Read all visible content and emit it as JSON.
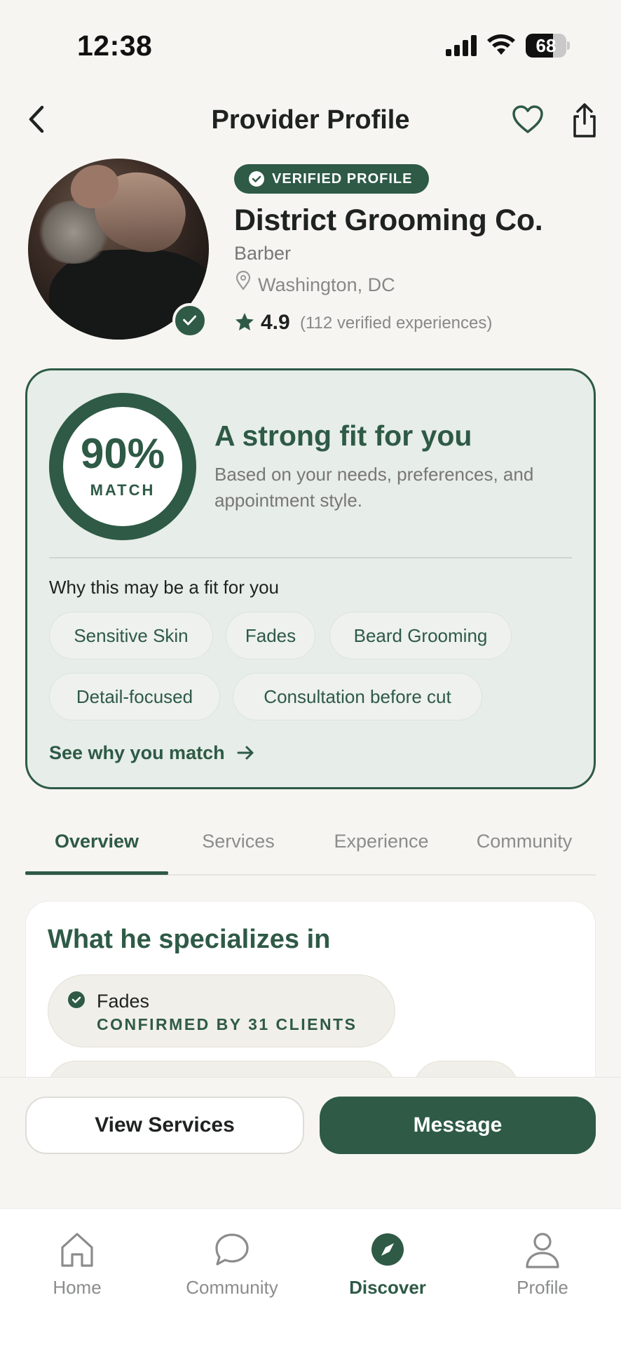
{
  "status_bar": {
    "time": "12:38",
    "battery": "68",
    "battery_level": 0.68
  },
  "header": {
    "title": "Provider Profile"
  },
  "profile": {
    "verified_label": "VERIFIED PROFILE",
    "name": "District Grooming Co.",
    "type": "Barber",
    "location": "Washington, DC",
    "rating": "4.9",
    "rating_count": "(112 verified experiences)"
  },
  "match": {
    "percent": "90%",
    "label": "MATCH",
    "headline": "A strong fit for you",
    "description": "Based on your needs, preferences, and appointment style.",
    "fit_heading": "Why this may be a fit for you",
    "chips": [
      "Sensitive Skin",
      "Fades",
      "Beard Grooming",
      "Detail-focused",
      "Consultation before cut"
    ],
    "see_why": "See why you match"
  },
  "tabs": [
    "Overview",
    "Services",
    "Experience",
    "Community"
  ],
  "specializes": {
    "title": "What he specializes in",
    "items": [
      {
        "name": "Fades",
        "sub": "CONFIRMED BY 31 CLIENTS"
      }
    ]
  },
  "actions": {
    "view_services": "View Services",
    "message": "Message"
  },
  "nav": [
    "Home",
    "Community",
    "Discover",
    "Profile"
  ],
  "colors": {
    "accent": "#2e5a46",
    "background": "#f7f5f1",
    "card_tint": "#e7ede8"
  },
  "icons": [
    "back-arrow-icon",
    "heart-icon",
    "share-icon",
    "check-icon",
    "location-pin-icon",
    "star-icon",
    "arrow-right-icon",
    "home-icon",
    "chat-icon",
    "compass-icon",
    "person-icon"
  ]
}
